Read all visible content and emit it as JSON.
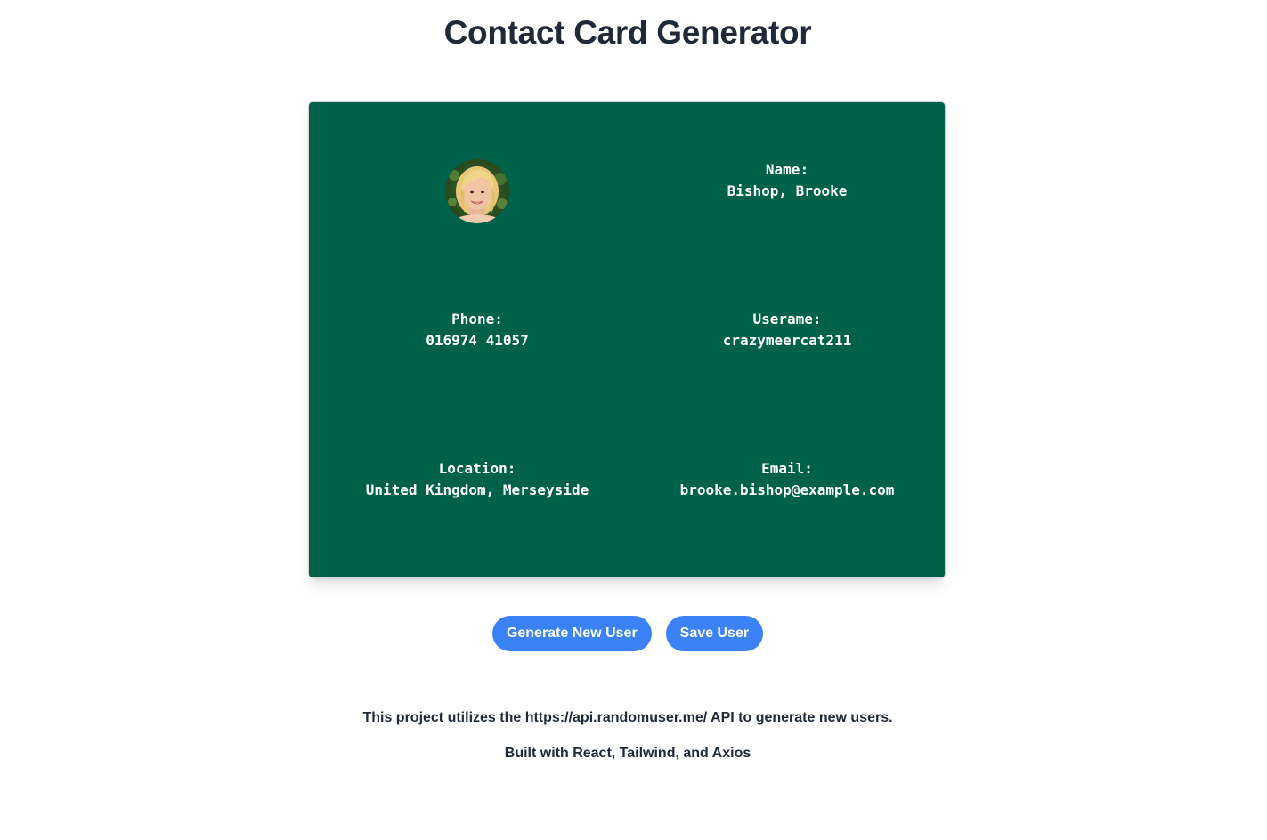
{
  "page": {
    "title": "Contact Card Generator"
  },
  "card": {
    "background_color": "#00614a",
    "avatar_alt": "user-avatar",
    "fields": {
      "name": {
        "label": "Name:",
        "value": "Bishop, Brooke"
      },
      "phone": {
        "label": "Phone:",
        "value": "016974 41057"
      },
      "username": {
        "label": "Userame:",
        "value": "crazymeercat211"
      },
      "location": {
        "label": "Location:",
        "value": "United Kingdom, Merseyside"
      },
      "email": {
        "label": "Email:",
        "value": "brooke.bishop@example.com"
      }
    }
  },
  "actions": {
    "generate_label": "Generate New User",
    "save_label": "Save User",
    "button_color": "#3b82f6"
  },
  "footer": {
    "api_note": "This project utilizes the https://api.randomuser.me/ API to generate new users.",
    "built_with": "Built with React, Tailwind, and Axios"
  }
}
